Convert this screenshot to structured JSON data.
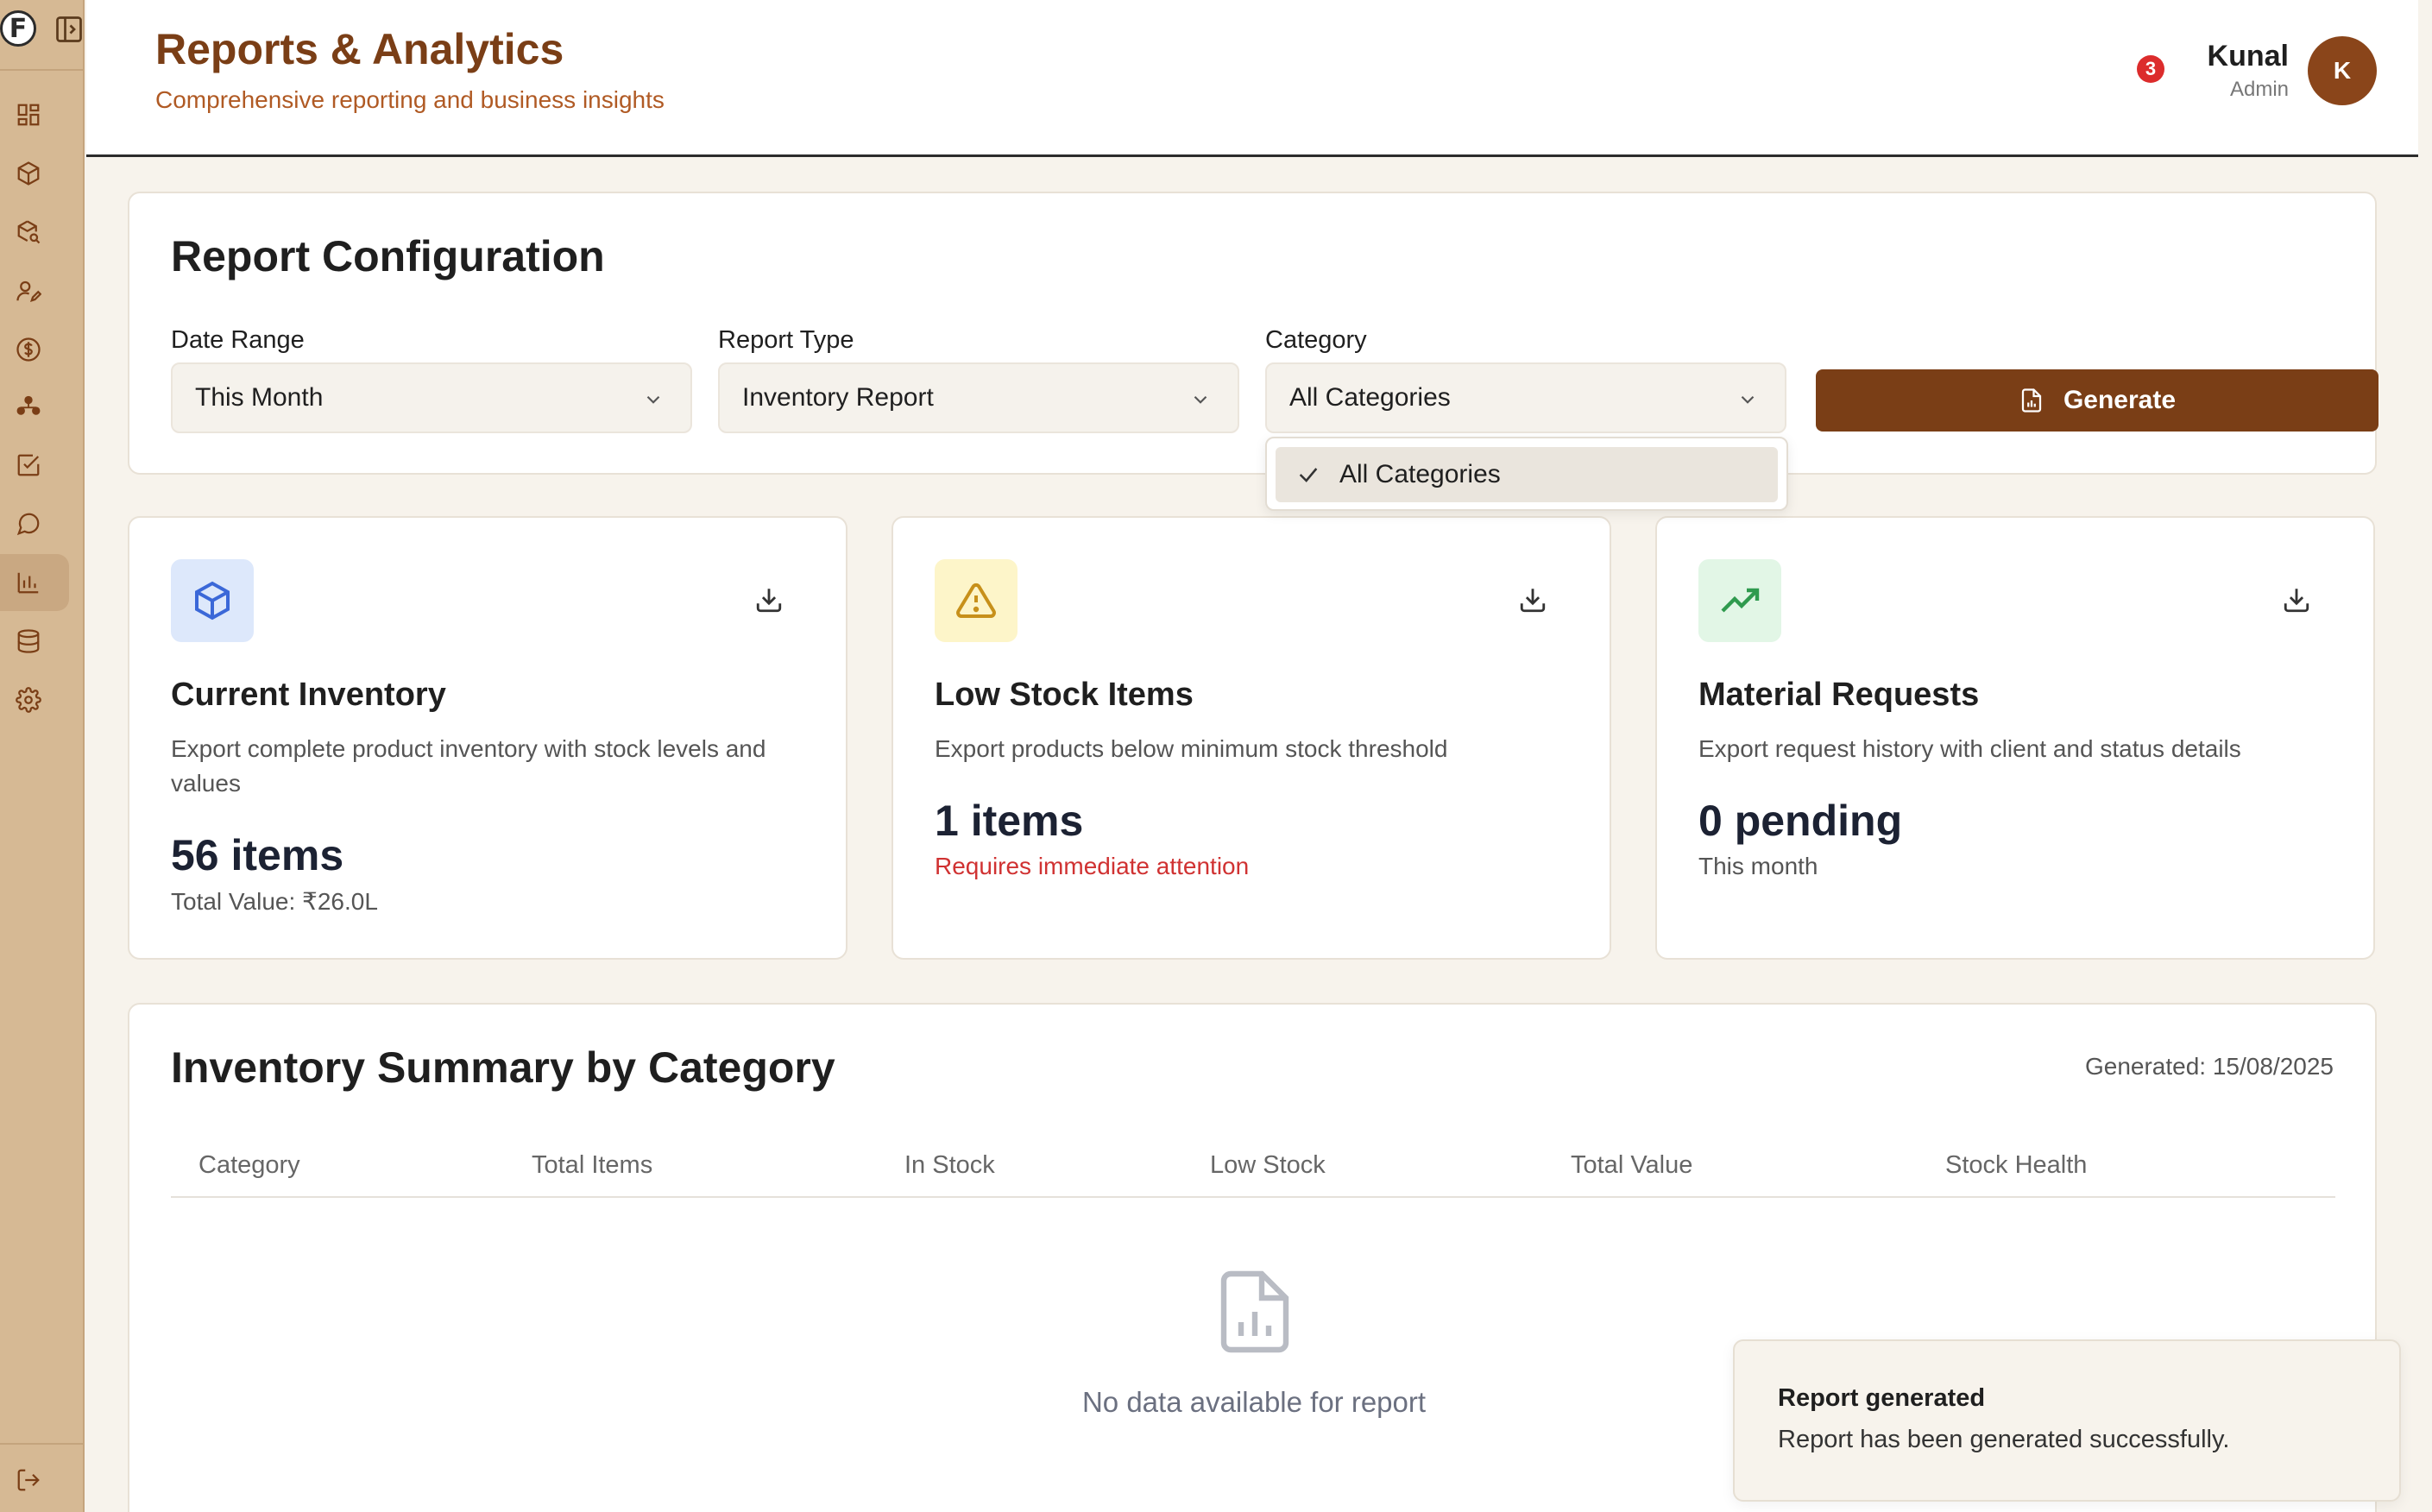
{
  "sidebar": {
    "logo_letter": "F",
    "items": [
      {
        "icon": "dashboard-icon"
      },
      {
        "icon": "box-icon"
      },
      {
        "icon": "box-search-icon"
      },
      {
        "icon": "user-edit-icon"
      },
      {
        "icon": "dollar-icon"
      },
      {
        "icon": "network-icon"
      },
      {
        "icon": "checklist-icon"
      },
      {
        "icon": "message-icon"
      },
      {
        "icon": "bar-chart-icon",
        "active": true
      },
      {
        "icon": "database-icon"
      },
      {
        "icon": "gear-icon"
      }
    ],
    "logout_icon": "logout-icon"
  },
  "header": {
    "title": "Reports & Analytics",
    "subtitle": "Comprehensive reporting and business insights",
    "notification_count": "3",
    "user_name": "Kunal",
    "user_role": "Admin",
    "avatar_initial": "K"
  },
  "config": {
    "title": "Report Configuration",
    "date_range_label": "Date Range",
    "date_range_value": "This Month",
    "report_type_label": "Report Type",
    "report_type_value": "Inventory Report",
    "category_label": "Category",
    "category_value": "All Categories",
    "generate_label": "Generate",
    "dropdown_options": [
      "All Categories"
    ]
  },
  "stats": [
    {
      "title": "Current Inventory",
      "description": "Export complete product inventory with stock levels and values",
      "value": "56 items",
      "sub": "Total Value: ₹26.0L",
      "icon": "box-icon",
      "icon_bg": "#dde8fb",
      "icon_color": "#3b68d8"
    },
    {
      "title": "Low Stock Items",
      "description": "Export products below minimum stock threshold",
      "value": "1 items",
      "sub": "Requires immediate attention",
      "icon": "warning-icon",
      "icon_bg": "#fdf5c9",
      "icon_color": "#c7901a"
    },
    {
      "title": "Material Requests",
      "description": "Export request history with client and status details",
      "value": "0 pending",
      "sub": "This month",
      "icon": "trending-up-icon",
      "icon_bg": "#e2f6e6",
      "icon_color": "#2f9a4e"
    }
  ],
  "summary": {
    "title": "Inventory Summary by Category",
    "generated": "Generated: 15/08/2025",
    "columns": [
      "Category",
      "Total Items",
      "In Stock",
      "Low Stock",
      "Total Value",
      "Stock Health"
    ],
    "empty_text": "No data available for report"
  },
  "toast": {
    "title": "Report generated",
    "message": "Report has been generated successfully."
  },
  "colors": {
    "brand": "#7a3e16",
    "sidebar": "#d6b994",
    "alert": "#d03232"
  }
}
